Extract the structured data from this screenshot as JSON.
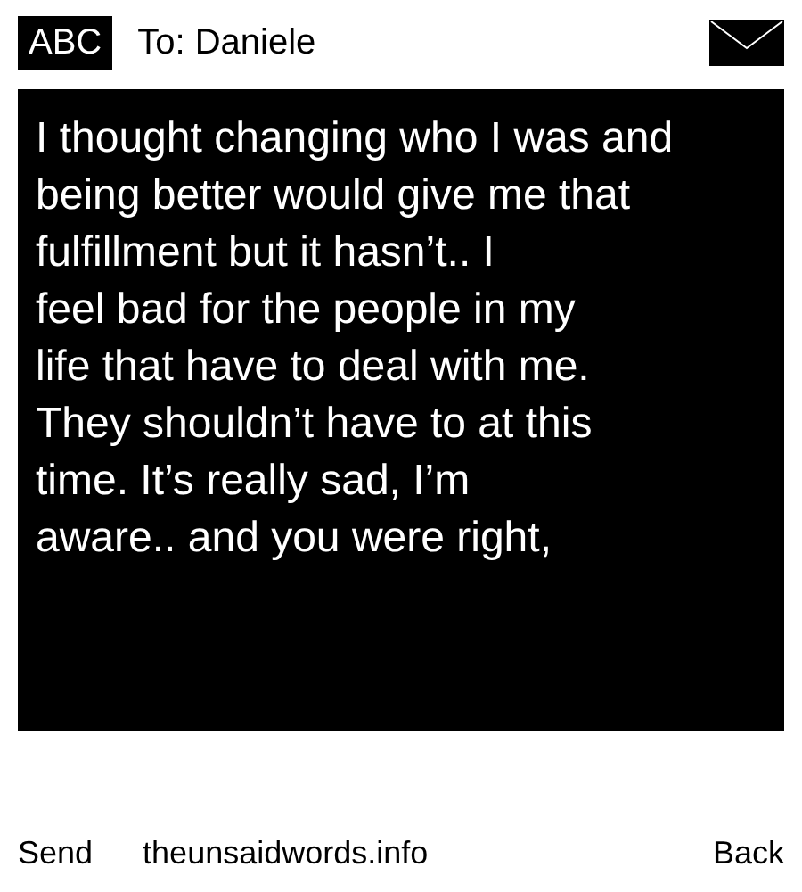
{
  "header": {
    "mode": "ABC",
    "recipient": "To: Daniele"
  },
  "message": "I thought changing who I was and\nbeing better would give me that\nfulfillment but it hasn’t.. I\nfeel bad for the people in my\nlife that have to deal with me.\nThey shouldn’t have to at this\ntime. It’s really sad, I’m\naware.. and you were right,",
  "softkeys": {
    "left": "Send",
    "center": "theunsaidwords.info",
    "right": "Back"
  }
}
